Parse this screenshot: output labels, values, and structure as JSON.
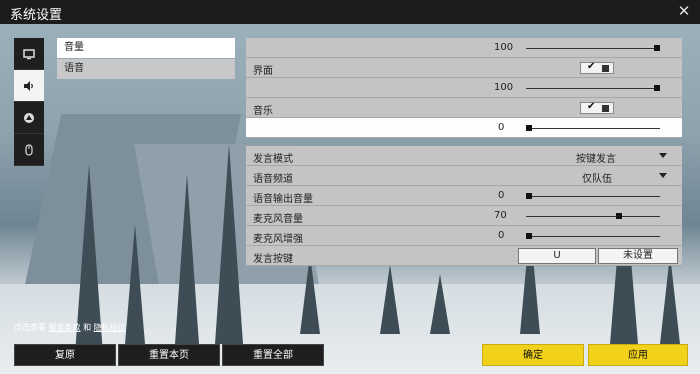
{
  "window": {
    "title": "系统设置",
    "close_icon": "close-icon"
  },
  "tabs": [
    {
      "name": "display-tab",
      "icon": "monitor-icon",
      "active": false
    },
    {
      "name": "audio-tab",
      "icon": "speaker-icon",
      "active": true
    },
    {
      "name": "controls-tab",
      "icon": "steering-icon",
      "active": false
    },
    {
      "name": "mouse-tab",
      "icon": "mouse-icon",
      "active": false
    }
  ],
  "submenu": {
    "items": [
      {
        "label": "音量",
        "active": true
      },
      {
        "label": "语音",
        "active": false
      }
    ]
  },
  "audio": {
    "master_value": "100",
    "master_level": 1.0,
    "ui_label": "界面",
    "ui_value": "100",
    "ui_level": 1.0,
    "ui_check": "✔",
    "music_label": "音乐",
    "music_value": "0",
    "music_level": 0.0,
    "music_check": "✔"
  },
  "voice": {
    "mode_label": "发言模式",
    "mode_value": "按键发言",
    "channel_label": "语音频道",
    "channel_value": "仅队伍",
    "output_label": "语音输出音量",
    "output_value": "0",
    "output_level": 0.0,
    "mic_label": "麦克风音量",
    "mic_value": "70",
    "mic_level": 0.7,
    "boost_label": "麦克风增强",
    "boost_value": "0",
    "boost_level": 0.0,
    "key_label": "发言按键",
    "key_primary": "U",
    "key_secondary": "未设置"
  },
  "footer": {
    "prefix": "点击查看",
    "terms": "服务条款",
    "and": "和",
    "privacy": "隐私协议"
  },
  "buttons": {
    "restore": "复原",
    "reset_page": "重置本页",
    "reset_all": "重置全部",
    "confirm": "确定",
    "apply": "应用"
  },
  "colors": {
    "accent": "#f2d11b",
    "titlebar": "#1c1c1c"
  }
}
